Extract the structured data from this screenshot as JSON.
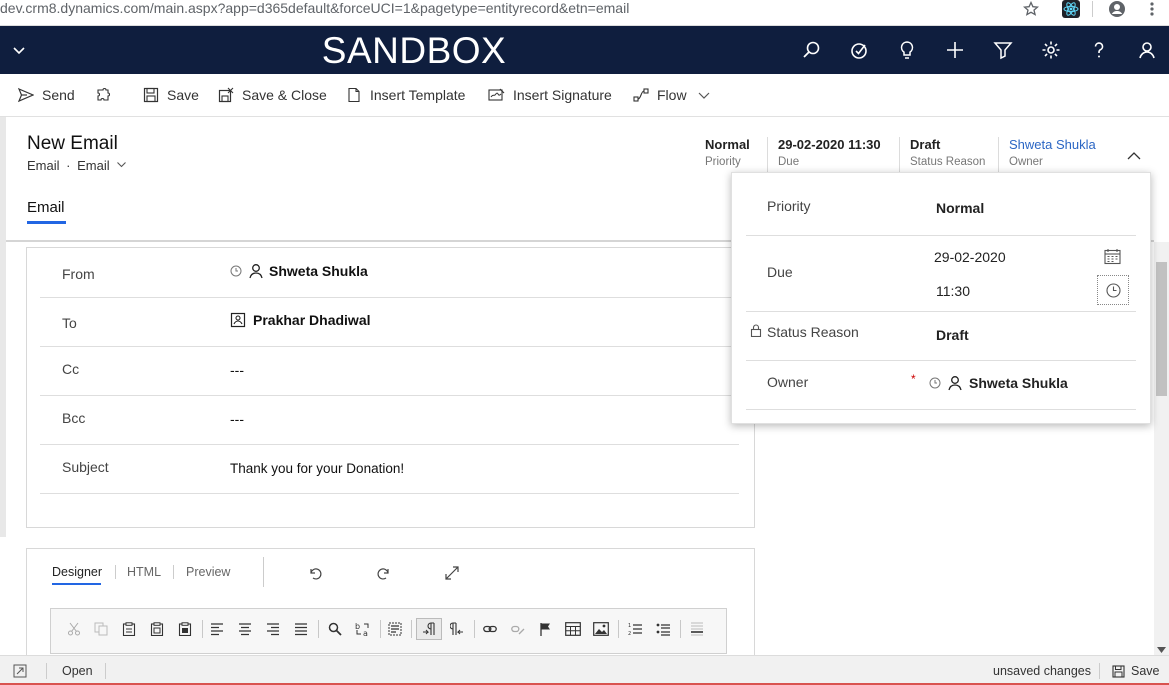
{
  "browser": {
    "url": "dev.crm8.dynamics.com/main.aspx?app=d365default&forceUCI=1&pagetype=entityrecord&etn=email"
  },
  "header": {
    "brand": "SANDBOX"
  },
  "commands": {
    "send": "Send",
    "save": "Save",
    "save_close": "Save & Close",
    "insert_template": "Insert Template",
    "insert_signature": "Insert Signature",
    "flow": "Flow"
  },
  "record": {
    "title": "New Email",
    "entity": "Email",
    "form": "Email",
    "separator": "·"
  },
  "header_fields": {
    "priority": {
      "value": "Normal",
      "label": "Priority"
    },
    "due": {
      "value": "29-02-2020 11:30",
      "label": "Due"
    },
    "status": {
      "value": "Draft",
      "label": "Status Reason"
    },
    "owner": {
      "value": "Shweta Shukla",
      "label": "Owner"
    }
  },
  "tabs": {
    "email": "Email"
  },
  "form": {
    "from": {
      "label": "From",
      "value": "Shweta Shukla"
    },
    "to": {
      "label": "To",
      "value": "Prakhar Dhadiwal"
    },
    "cc": {
      "label": "Cc",
      "value": "---"
    },
    "bcc": {
      "label": "Bcc",
      "value": "---"
    },
    "subject": {
      "label": "Subject",
      "value": "Thank you for your Donation!"
    }
  },
  "editor": {
    "tabs": [
      "Designer",
      "HTML",
      "Preview"
    ]
  },
  "flyout": {
    "priority": {
      "label": "Priority",
      "value": "Normal"
    },
    "due": {
      "label": "Due",
      "date": "29-02-2020",
      "time": "11:30"
    },
    "status": {
      "label": "Status Reason",
      "value": "Draft"
    },
    "owner": {
      "label": "Owner",
      "value": "Shweta Shukla",
      "required_mark": "*"
    }
  },
  "statusbar": {
    "open": "Open",
    "unsaved": "unsaved changes",
    "save": "Save"
  },
  "colors": {
    "navy": "#0f1e3e",
    "accent": "#2266e3",
    "link": "#2b66c4"
  }
}
